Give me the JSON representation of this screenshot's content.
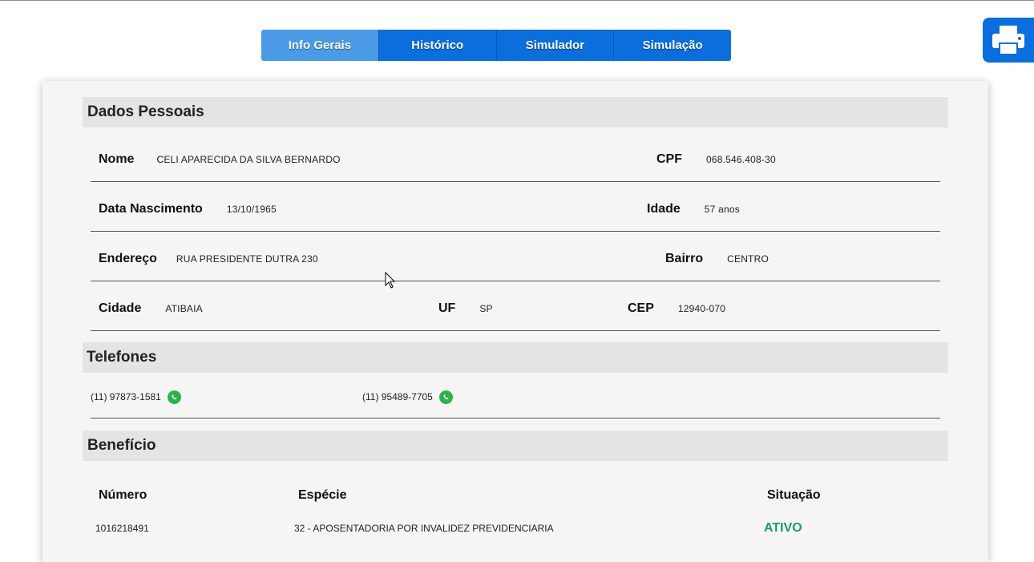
{
  "tabs": [
    {
      "label": "Info Gerais",
      "active": true
    },
    {
      "label": "Histórico",
      "active": false
    },
    {
      "label": "Simulador",
      "active": false
    },
    {
      "label": "Simulação",
      "active": false
    }
  ],
  "print_button": {
    "icon": "printer-icon"
  },
  "dados_pessoais": {
    "title": "Dados Pessoais",
    "nome": {
      "label": "Nome",
      "value": "CELI APARECIDA DA SILVA BERNARDO"
    },
    "cpf": {
      "label": "CPF",
      "value": "068.546.408-30"
    },
    "nascimento": {
      "label": "Data Nascimento",
      "value": "13/10/1965"
    },
    "idade": {
      "label": "Idade",
      "value": "57 anos"
    },
    "endereco": {
      "label": "Endereço",
      "value": "RUA PRESIDENTE DUTRA 230"
    },
    "bairro": {
      "label": "Bairro",
      "value": "CENTRO"
    },
    "cidade": {
      "label": "Cidade",
      "value": "ATIBAIA"
    },
    "uf": {
      "label": "UF",
      "value": "SP"
    },
    "cep": {
      "label": "CEP",
      "value": "12940-070"
    }
  },
  "telefones": {
    "title": "Telefones",
    "items": [
      {
        "number": "(11) 97873-1581",
        "icon": "whatsapp-icon"
      },
      {
        "number": "(11) 95489-7705",
        "icon": "whatsapp-icon"
      }
    ]
  },
  "beneficio": {
    "title": "Benefício",
    "headers": {
      "numero": "Número",
      "especie": "Espécie",
      "situacao": "Situação"
    },
    "row": {
      "numero": "1016218491",
      "especie": "32 - APOSENTADORIA POR INVALIDEZ PREVIDENCIARIA",
      "situacao": "ATIVO"
    }
  },
  "colors": {
    "primary": "#0a6fdc",
    "active_tab": "#4a9ae6",
    "whatsapp": "#2bb34a",
    "status_active": "#1a9a6a"
  }
}
